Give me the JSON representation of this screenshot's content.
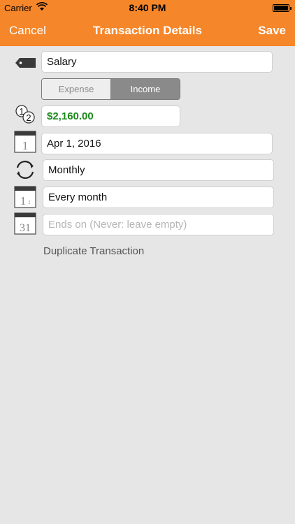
{
  "status": {
    "carrier": "Carrier",
    "time": "8:40 PM"
  },
  "nav": {
    "cancel": "Cancel",
    "title": "Transaction Details",
    "save": "Save"
  },
  "form": {
    "name": "Salary",
    "type_options": [
      "Expense",
      "Income"
    ],
    "type_selected": "Income",
    "amount": "$2,160.00",
    "date": "Apr 1, 2016",
    "frequency": "Monthly",
    "interval": "Every month",
    "end_placeholder": "Ends on (Never: leave empty)",
    "calendar_day_1": "1",
    "calendar_day_31": "31"
  },
  "actions": {
    "duplicate": "Duplicate Transaction"
  },
  "colors": {
    "nav": "#f5862a",
    "amount": "#1a8a1a",
    "background": "#e6e6e6"
  }
}
